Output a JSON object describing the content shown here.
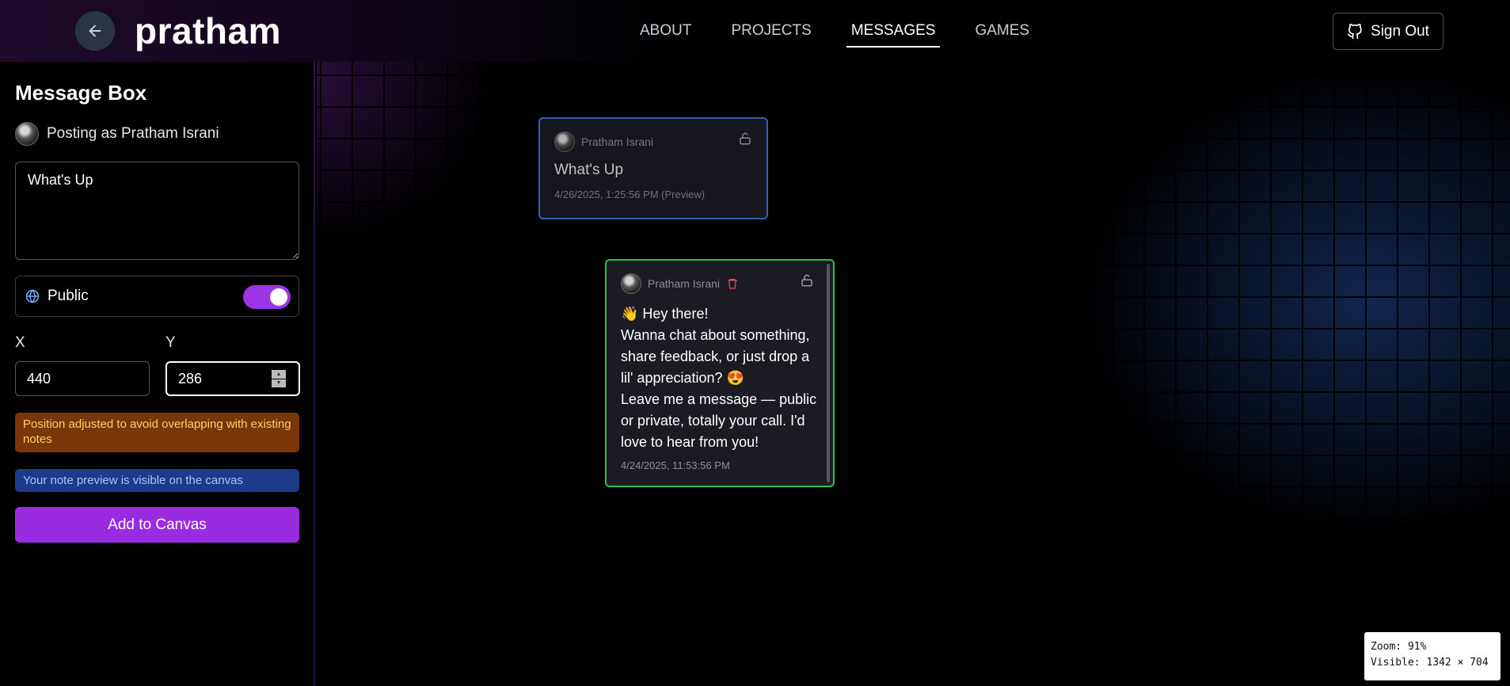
{
  "header": {
    "brand": "pratham",
    "nav": [
      {
        "label": "ABOUT"
      },
      {
        "label": "PROJECTS"
      },
      {
        "label": "MESSAGES"
      },
      {
        "label": "GAMES"
      }
    ],
    "active_nav": "MESSAGES",
    "signout_label": "Sign Out",
    "icons": {
      "back": "arrow-left-icon",
      "signout": "github-icon"
    }
  },
  "sidebar": {
    "title": "Message Box",
    "posting_as": "Posting as Pratham Israni",
    "message_value": "What's Up",
    "visibility_label": "Public",
    "visibility_on": true,
    "x_label": "X",
    "y_label": "Y",
    "x_value": "440",
    "y_value": "286",
    "warning": "Position adjusted to avoid overlapping with existing notes",
    "info": "Your note preview is visible on the canvas",
    "add_button": "Add to Canvas",
    "colors": {
      "accent": "#9b2be0",
      "warning_bg": "#7a3508",
      "info_bg": "#1f3a8a"
    }
  },
  "canvas": {
    "preview_note": {
      "author": "Pratham Israni",
      "body": "What's Up",
      "date": "4/26/2025, 1:25:56 PM (Preview)",
      "border_color": "#3a74c9"
    },
    "note": {
      "author": "Pratham Israni",
      "body": "👋 Hey there!\nWanna chat about something, share feedback, or just drop a lil' appreciation? 😍\nLeave me a message — public or private, totally your call. I'd love to hear from you!",
      "date": "4/24/2025, 11:53:56 PM",
      "border_color": "#27c24a"
    },
    "zoom": "Zoom: 91%",
    "visible": "Visible: 1342 × 704"
  }
}
